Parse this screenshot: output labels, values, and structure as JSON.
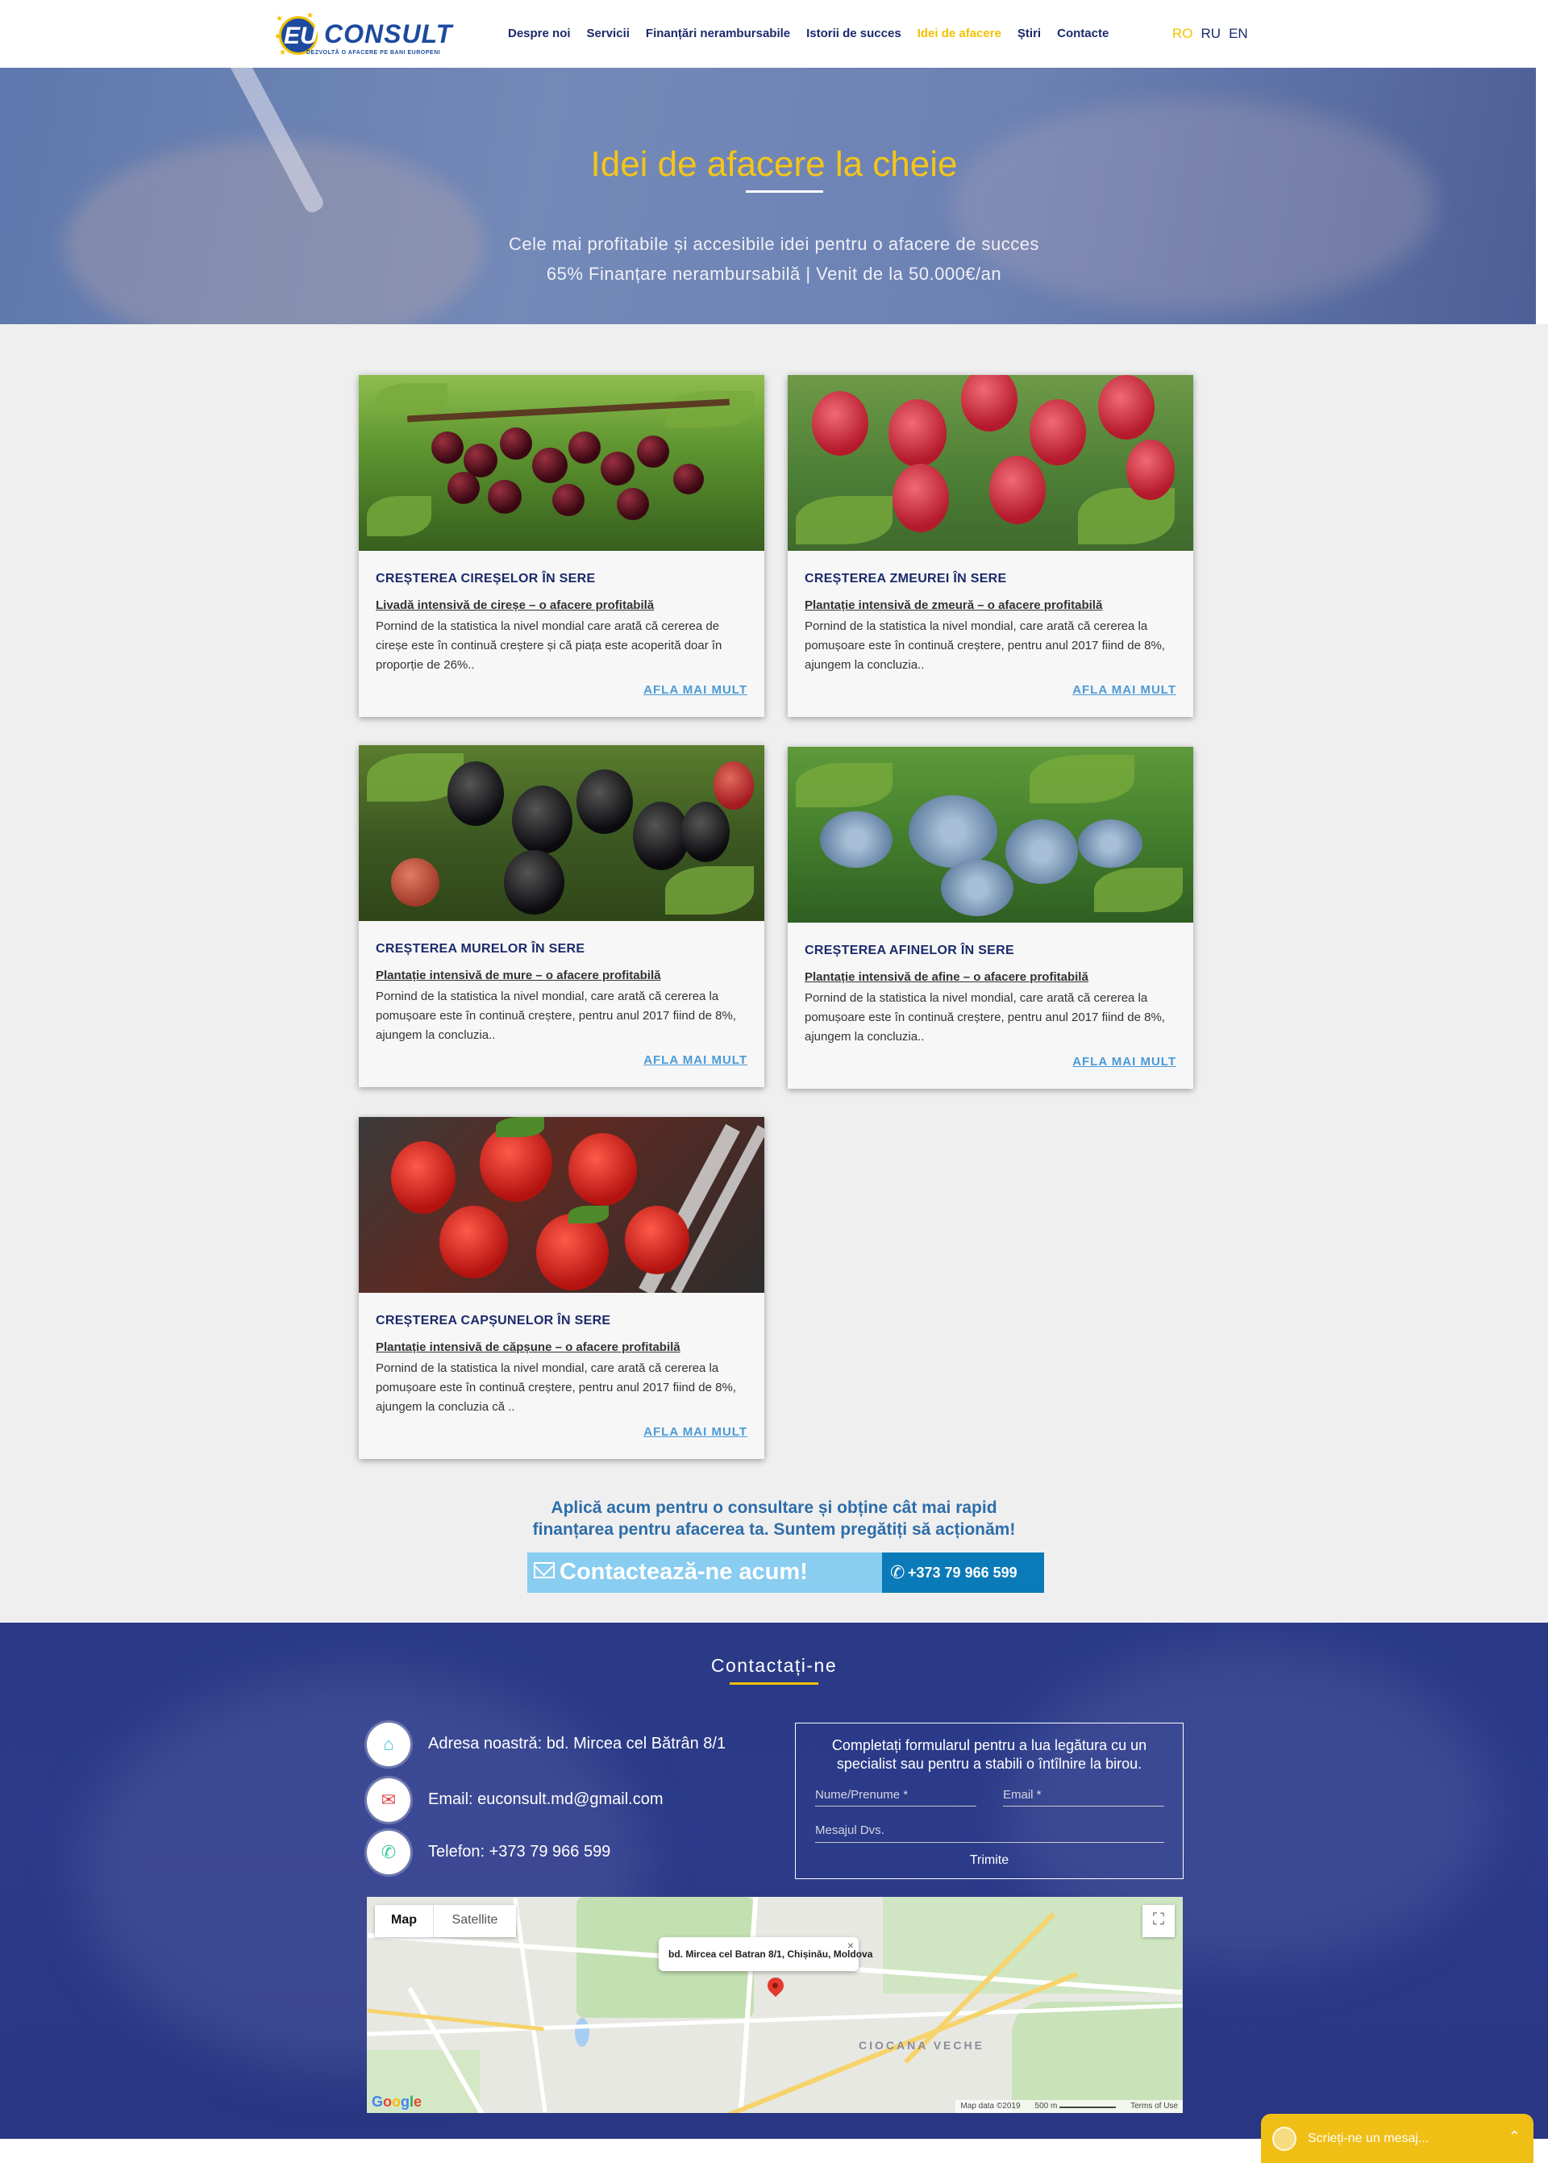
{
  "header": {
    "logo": {
      "eu": "EU",
      "consult": "CONSULT",
      "tagline": "DEZVOLTĂ O AFACERE PE BANI EUROPENI"
    },
    "nav": [
      {
        "label": "Despre noi"
      },
      {
        "label": "Servicii"
      },
      {
        "label": "Finanțări nerambursabile"
      },
      {
        "label": "Istorii de succes"
      },
      {
        "label": "Idei de afacere",
        "active": true
      },
      {
        "label": "Știri"
      },
      {
        "label": "Contacte"
      }
    ],
    "languages": [
      "RO",
      "RU",
      "EN"
    ],
    "active_language": "RO"
  },
  "hero": {
    "title": "Idei de afacere la cheie",
    "subtitle_1": "Cele mai profitabile și accesibile idei pentru o afacere de succes",
    "subtitle_2": "65% Finanțare nerambursabilă | Venit de la 50.000€/an"
  },
  "cards": [
    {
      "image": "cherries-photo",
      "title": "CREȘTEREA CIREȘELOR ÎN SERE",
      "subtitle": "Livadă intensivă de cireșe – o afacere profitabilă",
      "text": "Pornind de la statistica la nivel mondial care arată că cererea de cireșe este în continuă creștere și că piața este acoperită doar în proporție de 26%..",
      "button": "AFLA MAI MULT"
    },
    {
      "image": "raspberries-photo",
      "title": "CREȘTEREA ZMEUREI ÎN SERE",
      "subtitle": "Plantație intensivă de zmeură – o afacere profitabilă",
      "text": "Pornind de la statistica la nivel mondial, care arată că cererea la pomușoare este în continuă creștere, pentru anul 2017 fiind de 8%, ajungem la concluzia..",
      "button": "AFLA MAI MULT"
    },
    {
      "image": "blackberries-photo",
      "title": "CREȘTEREA MURELOR ÎN SERE",
      "subtitle": "Plantație intensivă de mure – o afacere profitabilă",
      "text": "Pornind de la statistica la nivel mondial, care arată că cererea la pomușoare este în continuă creștere, pentru anul 2017 fiind de 8%, ajungem la concluzia..",
      "button": "AFLA MAI MULT"
    },
    {
      "image": "blueberries-photo",
      "title": "CREȘTEREA AFINELOR ÎN SERE",
      "subtitle": "Plantație intensivă de afine – o afacere profitabilă",
      "text": "Pornind de la statistica la nivel mondial, care arată că cererea la pomușoare este în continuă creștere, pentru anul 2017 fiind de 8%, ajungem la concluzia..",
      "button": "AFLA MAI MULT"
    },
    {
      "image": "strawberries-photo",
      "title": "CREȘTEREA CAPȘUNELOR ÎN SERE",
      "subtitle": "Plantație intensivă de căpșune – o afacere profitabilă",
      "text": "Pornind de la statistica la nivel mondial, care arată că cererea la pomușoare este în continuă creștere, pentru anul 2017 fiind de 8%, ajungem la concluzia că ..",
      "button": "AFLA MAI MULT"
    }
  ],
  "cta": {
    "line_1": "Aplică acum pentru o consultare și obține cât mai rapid",
    "line_2": "finanțarea pentru afacerea ta. Suntem pregătiți să acționăm!",
    "contact_button": "Contactează-ne acum!",
    "phone_button": "+373 79 966 599"
  },
  "contact": {
    "title": "Contactați-ne",
    "address": "Adresa noastră: bd. Mircea cel Bătrân 8/1",
    "email": "Email: euconsult.md@gmail.com",
    "phone": "Telefon: +373 79 966 599",
    "form": {
      "title_1": "Completați formularul pentru a lua legătura cu un",
      "title_2": "specialist sau pentru a stabili o întîlnire la birou.",
      "name_placeholder": "Nume/Prenume *",
      "email_placeholder": "Email *",
      "message_placeholder": "Mesajul Dvs.",
      "submit": "Trimite"
    }
  },
  "map": {
    "tab_map": "Map",
    "tab_satellite": "Satellite",
    "popup": "bd. Mircea cel Batran 8/1, Chișinău, Moldova",
    "district": "CIOCANA VECHE",
    "attribution": "Map data ©2019",
    "scale": "500 m",
    "terms": "Terms of Use",
    "google": "Google"
  },
  "chat": {
    "placeholder": "Scrieți-ne un mesaj..."
  },
  "colors": {
    "brand_blue": "#1b2a6b",
    "accent_yellow": "#f2c200",
    "link_blue": "#4a9ad8",
    "cta_blue": "#2d6da9"
  }
}
